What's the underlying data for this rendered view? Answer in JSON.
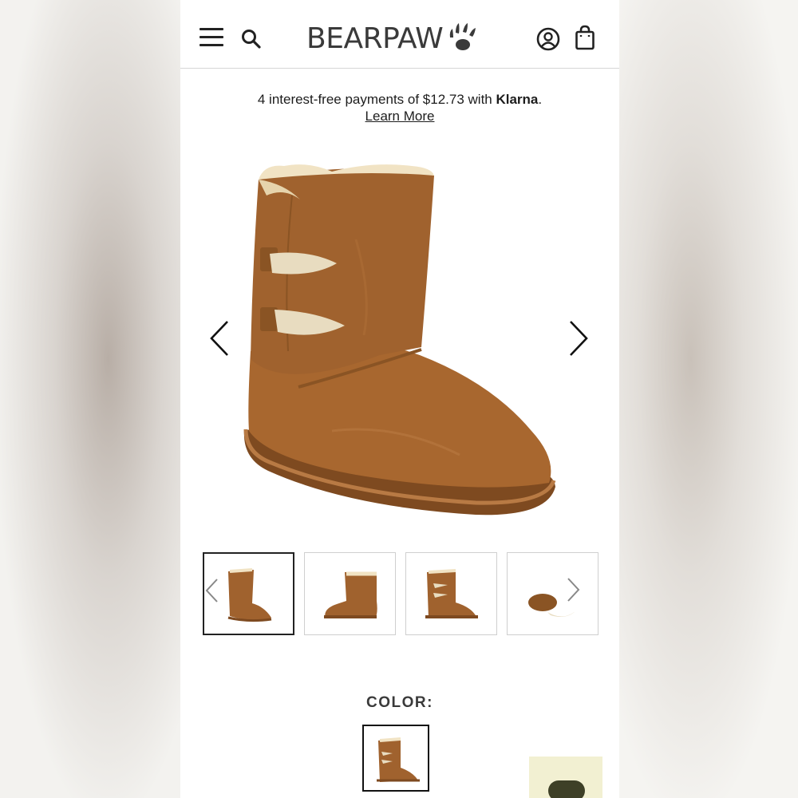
{
  "header": {
    "logo_text": "BEARPAW",
    "menu_icon": "hamburger-menu-icon",
    "search_icon": "search-icon",
    "account_icon": "account-icon",
    "cart_icon": "shopping-bag-icon"
  },
  "klarna": {
    "prefix": "4 interest-free payments of $12.73 with ",
    "brand": "Klarna",
    "suffix": ".",
    "learn_more": "Learn More"
  },
  "gallery": {
    "prev_icon": "chevron-left-icon",
    "next_icon": "chevron-right-icon",
    "thumbnails": [
      {
        "view": "side",
        "active": true
      },
      {
        "view": "front",
        "active": false
      },
      {
        "view": "toggle-side",
        "active": false
      },
      {
        "view": "sole",
        "active": false
      }
    ]
  },
  "color": {
    "label": "COLOR:",
    "selected_swatch": "hickory"
  },
  "colors": {
    "boot": "#a0622e",
    "boot_dark": "#7e4a20",
    "fleece": "#f1e3c4",
    "toggle": "#e8dcc0",
    "chat_bg": "#f2f0d2",
    "chat_pill": "#3e4027"
  }
}
